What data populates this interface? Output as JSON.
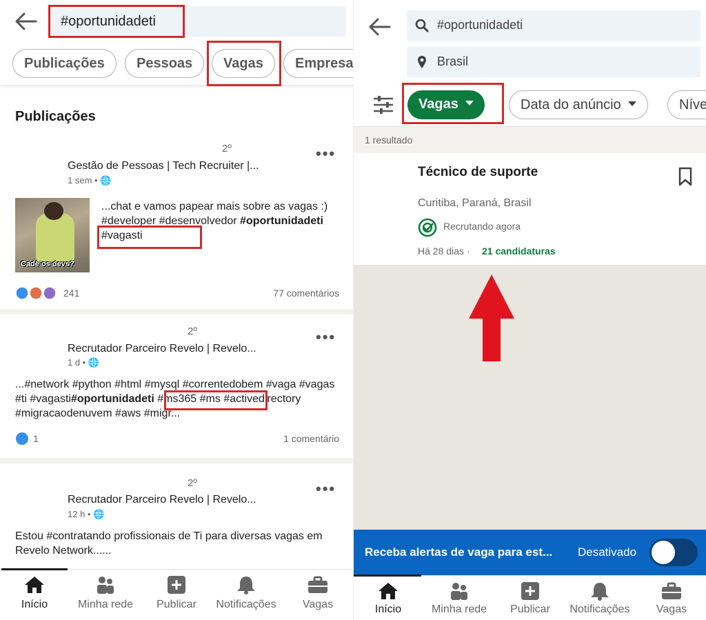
{
  "left": {
    "search": {
      "query": "#oportunidadeti"
    },
    "chips": [
      "Publicações",
      "Pessoas",
      "Vagas",
      "Empresa"
    ],
    "section_title": "Publicações",
    "posts": [
      {
        "degree": "2º",
        "author": "Gestão de Pessoas | Tech Recruiter |...",
        "meta": "1 sem •",
        "body_pre": "...chat e vamos papear mais sobre as vagas :)  #developer #desenvolvedor",
        "body_hl": "#oportunidadeti",
        "body_post": " #vagasti",
        "image_caption": "Cadê os devs?",
        "reactions": "241",
        "comments": "77 comentários"
      },
      {
        "degree": "2º",
        "author": "Recrutador Parceiro Revelo | Revelo...",
        "meta": "1 d •",
        "body_pre": "...#network #python #html #mysql #correntedobem #vaga #vagas #ti #vagasti",
        "body_hl": "#oportunidadeti",
        "body_post": " #ms365 #ms #activedirectory #migracaodenuvem #aws #migr...",
        "reactions": "1",
        "comments": "1 comentário"
      },
      {
        "degree": "2º",
        "author": "Recrutador Parceiro Revelo | Revelo...",
        "meta": "12 h •",
        "body": "Estou #contratando profissionais de Ti para diversas vagas em Revelo Network......"
      }
    ],
    "nav": [
      {
        "label": "Início",
        "icon": "home-icon"
      },
      {
        "label": "Minha rede",
        "icon": "network-icon"
      },
      {
        "label": "Publicar",
        "icon": "plus-icon"
      },
      {
        "label": "Notificações",
        "icon": "bell-icon"
      },
      {
        "label": "Vagas",
        "icon": "briefcase-icon"
      }
    ]
  },
  "right": {
    "search": {
      "query": "#oportunidadeti",
      "location": "Brasil"
    },
    "filters": [
      "Vagas",
      "Data do anúncio",
      "Níve"
    ],
    "results": "1 resultado",
    "job": {
      "title": "Técnico de suporte",
      "location": "Curitiba, Paraná, Brasil",
      "recruiting": "Recrutando agora",
      "posted": "Há 28 dias",
      "applications": "21 candidaturas"
    },
    "alert": {
      "text": "Receba alertas de vaga para est...",
      "status": "Desativado"
    },
    "nav": [
      {
        "label": "Início",
        "icon": "home-icon"
      },
      {
        "label": "Minha rede",
        "icon": "network-icon"
      },
      {
        "label": "Publicar",
        "icon": "plus-icon"
      },
      {
        "label": "Notificações",
        "icon": "bell-icon"
      },
      {
        "label": "Vagas",
        "icon": "briefcase-icon"
      }
    ]
  },
  "colors": {
    "highlight": "#d22a2a",
    "accent_green": "#0d7a3e",
    "alert_blue": "#0a66c2",
    "arrow_red": "#e0141e"
  }
}
